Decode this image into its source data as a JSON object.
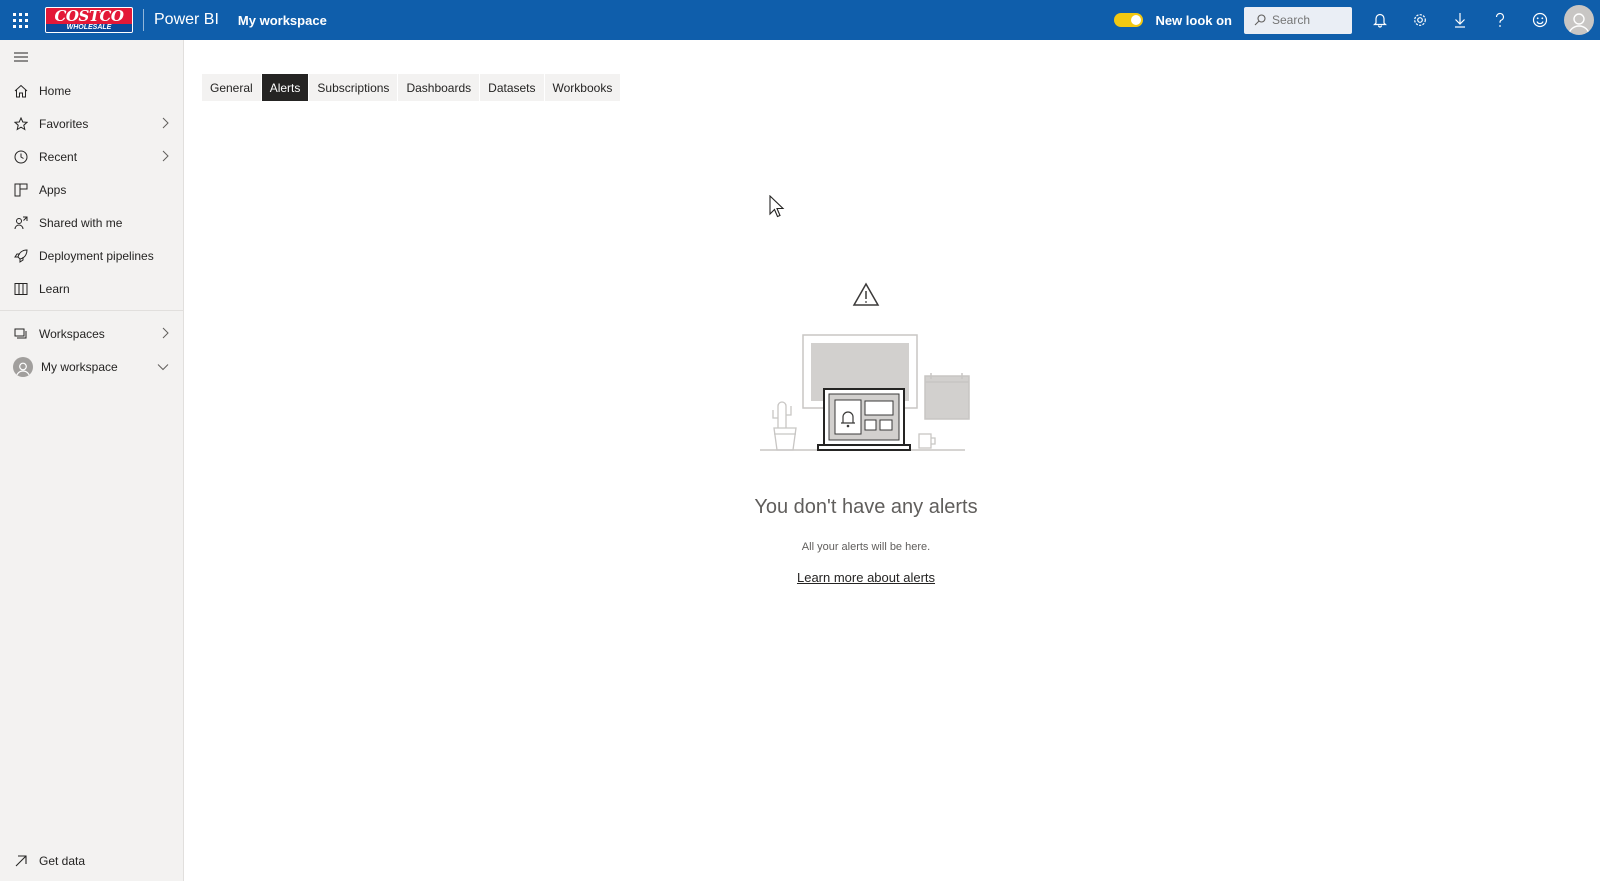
{
  "topbar": {
    "logo_text": "COSTCO",
    "logo_subtext": "WHOLESALE",
    "brand": "Power BI",
    "breadcrumb": "My workspace",
    "new_look_label": "New look on",
    "new_look_on": true,
    "search_placeholder": "Search",
    "icons": [
      "app-launcher-icon",
      "bell-icon",
      "gear-icon",
      "download-icon",
      "help-icon",
      "smiley-icon",
      "user-icon"
    ],
    "bar_color": "#0f5eab",
    "toggle_color": "#f2c811"
  },
  "sidebar": {
    "items": [
      {
        "label": "Home",
        "icon": "home-icon"
      },
      {
        "label": "Favorites",
        "icon": "star-icon"
      },
      {
        "label": "Recent",
        "icon": "clock-icon"
      },
      {
        "label": "Apps",
        "icon": "apps-icon"
      },
      {
        "label": "Shared with me",
        "icon": "shared-icon"
      },
      {
        "label": "Deployment pipelines",
        "icon": "rocket-icon"
      },
      {
        "label": "Learn",
        "icon": "book-icon"
      }
    ],
    "workspaces_label": "Workspaces",
    "my_workspace_label": "My workspace",
    "get_data_label": "Get data"
  },
  "tabs": {
    "items": [
      "General",
      "Alerts",
      "Subscriptions",
      "Dashboards",
      "Datasets",
      "Workbooks"
    ],
    "active": "Alerts",
    "active_color": "#252423"
  },
  "empty_state": {
    "title": "You don't have any alerts",
    "subtitle": "All your alerts will be here.",
    "link": "Learn more about alerts"
  }
}
